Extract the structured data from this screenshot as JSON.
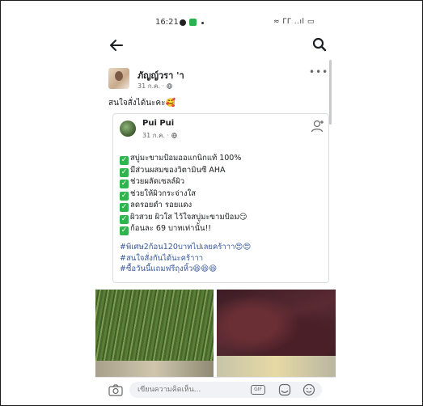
{
  "status_bar": {
    "time": "16:21",
    "signal_text": "≈ ΓΓ ..ıl ▭"
  },
  "post": {
    "author": "ภัญญ์วรา 'า",
    "meta": "31 ก.ค. ·",
    "text": "สนใจสั่งได้นะคะ🥰"
  },
  "shared_post": {
    "author": "Pui Pui",
    "meta": "31 ก.ค. ·",
    "items": [
      "สบู่มะขามป้อมออแกนิกแท้ 100%",
      "มีส่วนผสมของวิตามินซี AHA",
      "ช่วยผลัดเซลล์ผิว",
      "ช่วยให้ผิวกระจ่างใส",
      "ลดรอยดำ รอยแดง",
      "ผิวสวย ผิวใส ไว้ใจสบู่มะขามป้อม😏",
      "ก้อนละ 69 บาทเท่านั้น!!"
    ],
    "hashtags": [
      "#พิเศษ2ก้อน120บาทไปเลยคร้าาา😍😍",
      "#สนใจสั่งกันได้นะคร้าาา",
      "#ซื้อวันนี้แถมฟรีถุงหิ้ว😆😆😆"
    ]
  },
  "composer": {
    "placeholder": "เขียนความคิดเห็น...",
    "gif_label": "GIF"
  },
  "colors": {
    "check_green": "#2fb54d",
    "hashtag_blue": "#385898"
  }
}
